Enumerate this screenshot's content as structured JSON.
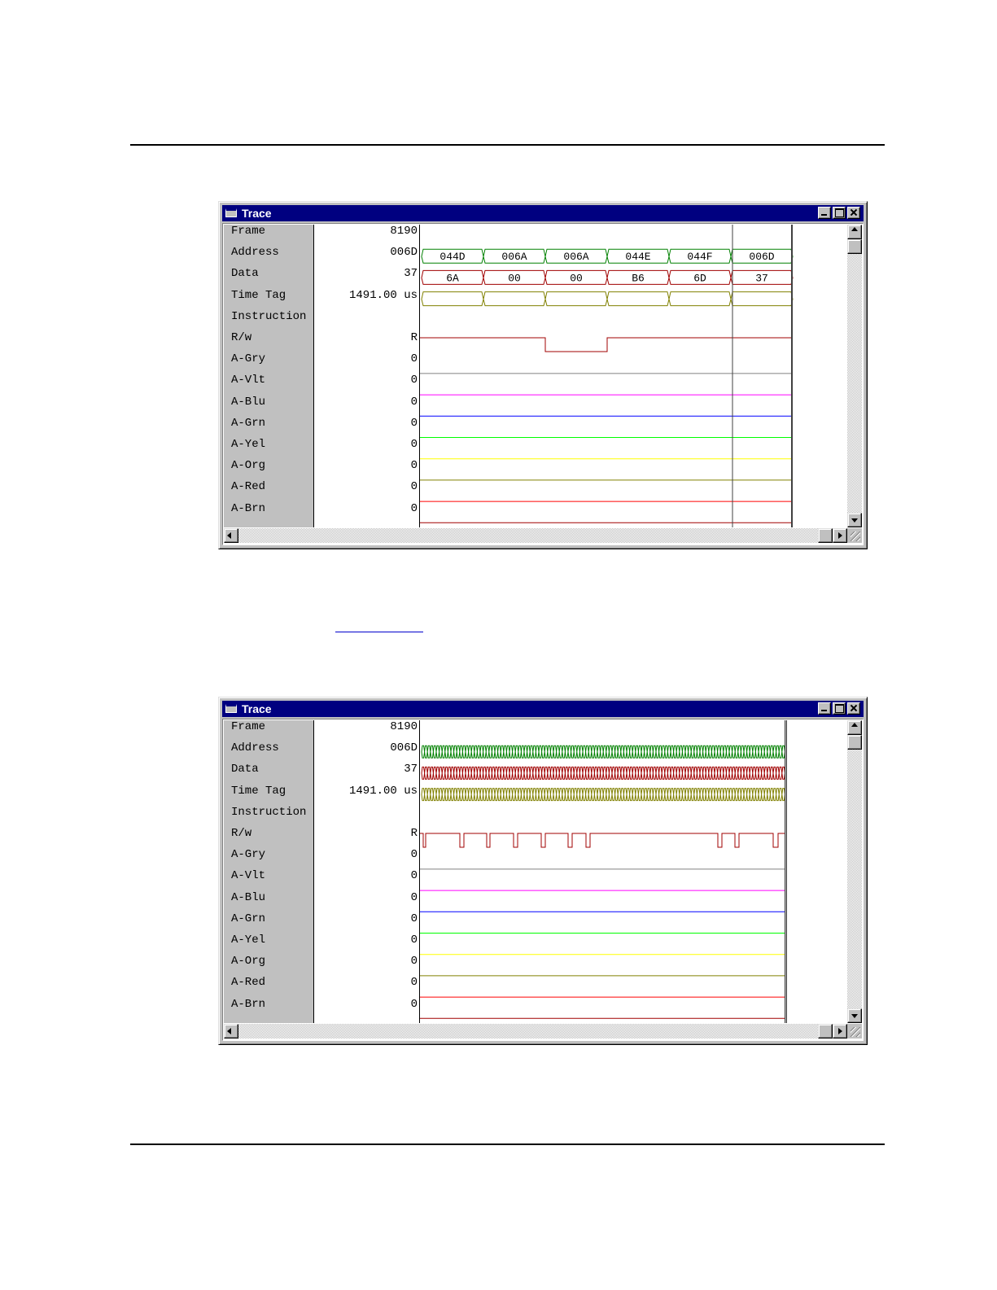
{
  "windows": [
    {
      "title": "Trace",
      "rows": [
        {
          "name": "Frame",
          "value": "8190",
          "color": ""
        },
        {
          "name": "Address",
          "value": "006D",
          "color": "#008000"
        },
        {
          "name": "Data",
          "value": "37",
          "color": "#a00000"
        },
        {
          "name": "Time Tag",
          "value": "1491.00 us",
          "color": "#808000"
        },
        {
          "name": "Instruction",
          "value": "",
          "color": ""
        },
        {
          "name": "R/w",
          "value": "R",
          "color": "#a00000"
        },
        {
          "name": "A-Gry",
          "value": "0",
          "color": "#808080"
        },
        {
          "name": "A-Vlt",
          "value": "0",
          "color": "#ff00ff"
        },
        {
          "name": "A-Blu",
          "value": "0",
          "color": "#0000ff"
        },
        {
          "name": "A-Grn",
          "value": "0",
          "color": "#00ff00"
        },
        {
          "name": "A-Yel",
          "value": "0",
          "color": "#ffff00"
        },
        {
          "name": "A-Org",
          "value": "0",
          "color": "#808000"
        },
        {
          "name": "A-Red",
          "value": "0",
          "color": "#ff0000"
        },
        {
          "name": "A-Brn",
          "value": "0",
          "color": "#a00000"
        }
      ],
      "segments": {
        "address": [
          "044D",
          "006A",
          "006A",
          "044E",
          "044F",
          "006D"
        ],
        "data": [
          "6A",
          "00",
          "00",
          "B6",
          "6D",
          "37"
        ]
      },
      "rw_levels": [
        "high",
        "high",
        "low",
        "high",
        "high",
        "high"
      ]
    },
    {
      "title": "Trace",
      "rows": [
        {
          "name": "Frame",
          "value": "8190",
          "color": ""
        },
        {
          "name": "Address",
          "value": "006D",
          "color": "#008000"
        },
        {
          "name": "Data",
          "value": "37",
          "color": "#a00000"
        },
        {
          "name": "Time Tag",
          "value": "1491.00 us",
          "color": "#808000"
        },
        {
          "name": "Instruction",
          "value": "",
          "color": ""
        },
        {
          "name": "R/w",
          "value": "R",
          "color": "#a00000"
        },
        {
          "name": "A-Gry",
          "value": "0",
          "color": "#808080"
        },
        {
          "name": "A-Vlt",
          "value": "0",
          "color": "#ff00ff"
        },
        {
          "name": "A-Blu",
          "value": "0",
          "color": "#0000ff"
        },
        {
          "name": "A-Grn",
          "value": "0",
          "color": "#00ff00"
        },
        {
          "name": "A-Yel",
          "value": "0",
          "color": "#ffff00"
        },
        {
          "name": "A-Org",
          "value": "0",
          "color": "#808000"
        },
        {
          "name": "A-Red",
          "value": "0",
          "color": "#ff0000"
        },
        {
          "name": "A-Brn",
          "value": "0",
          "color": "#a00000"
        }
      ],
      "dense_bus": true
    }
  ],
  "colors": {
    "titlebar": "#000080",
    "panel": "#c0c0c0"
  }
}
